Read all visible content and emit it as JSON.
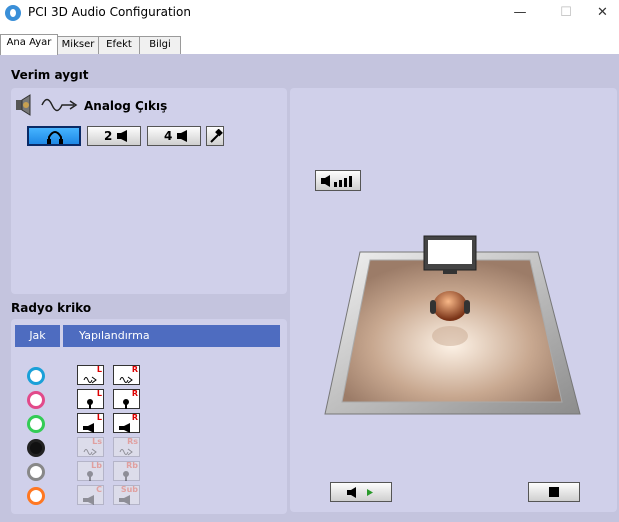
{
  "window": {
    "title": "PCI 3D Audio Configuration",
    "minimize": "—",
    "maximize": "☐",
    "close": "✕"
  },
  "tabs": [
    {
      "label": "Ana Ayar",
      "active": true
    },
    {
      "label": "Mikser"
    },
    {
      "label": "Efekt"
    },
    {
      "label": "Bilgi"
    }
  ],
  "device": {
    "section_title": "Verim aygıt",
    "output_label": "Analog Çıkış",
    "buttons": [
      {
        "icon": "headphones-icon",
        "selected": true
      },
      {
        "label": "2",
        "icon": "speaker-icon"
      },
      {
        "label": "4",
        "icon": "speaker-icon"
      },
      {
        "icon": "hammer-icon"
      }
    ]
  },
  "jacks": {
    "section_title": "Radyo kriko",
    "col_jack": "Jak",
    "col_config": "Yapılandırma",
    "rows": [
      {
        "color": "#1aa0d8",
        "left": "L",
        "right": "R",
        "enabled": true
      },
      {
        "color": "#e24a8a",
        "left": "L",
        "right": "R",
        "enabled": true
      },
      {
        "color": "#33cc55",
        "left": "L",
        "right": "R",
        "enabled": true
      },
      {
        "color": "#222222",
        "left": "Ls",
        "right": "Rs",
        "enabled": false
      },
      {
        "color": "#888888",
        "left": "Lb",
        "right": "Rb",
        "enabled": false
      },
      {
        "color": "#ff7722",
        "left": "C",
        "right": "Sub",
        "enabled": false
      }
    ]
  },
  "colors": {
    "accent_blue": "#4e6cc0",
    "panel": "#d0d0ea",
    "background": "#c4c4de"
  }
}
